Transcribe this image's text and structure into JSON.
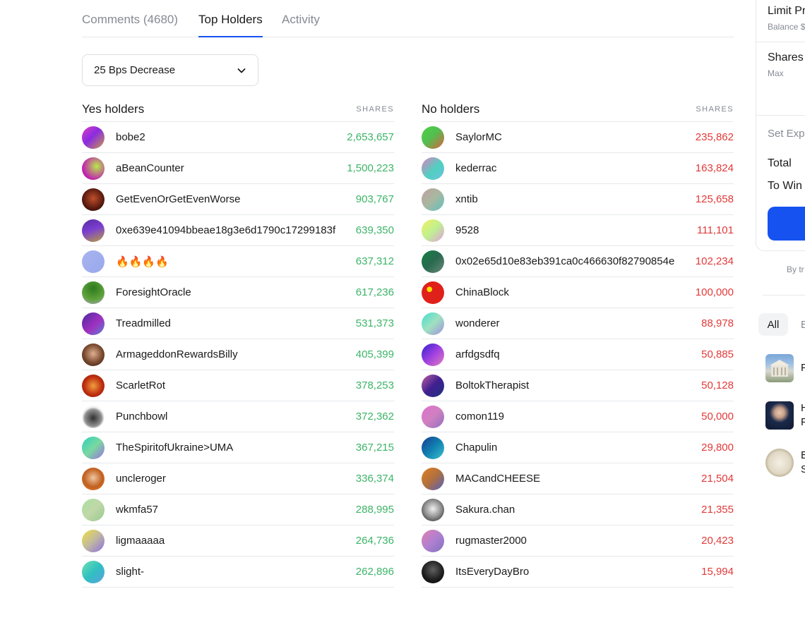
{
  "tabs": [
    {
      "label": "Comments (4680)",
      "active": false
    },
    {
      "label": "Top Holders",
      "active": true
    },
    {
      "label": "Activity",
      "active": false
    }
  ],
  "dropdown": {
    "selected": "25 Bps Decrease",
    "icon": "chevron-down-icon"
  },
  "yes_holders": {
    "title": "Yes holders",
    "shares_label": "SHARES",
    "color": "#3db468",
    "rows": [
      {
        "name": "bobe2",
        "shares": "2,653,657",
        "avatar": "linear-gradient(135deg,#e040c0,#8a2be2 45%,#c89a4a)"
      },
      {
        "name": "aBeanCounter",
        "shares": "1,500,223",
        "avatar": "radial-gradient(circle at 65% 40%,#b8e94a,#c020b0 70%)"
      },
      {
        "name": "GetEvenOrGetEvenWorse",
        "shares": "903,767",
        "avatar": "radial-gradient(circle at 50% 45%,#c0502a,#5a1a10 60%,#1a0a08)"
      },
      {
        "name": "0xe639e41094bbeae18g3e6d1790c17299183f",
        "shares": "639,350",
        "avatar": "linear-gradient(160deg,#5a2aa0,#7a3fd0 45%,#b8a040)"
      },
      {
        "name": "🔥🔥🔥🔥",
        "shares": "637,312",
        "avatar": "linear-gradient(135deg,#a8b4f0,#98a8ec)"
      },
      {
        "name": "ForesightOracle",
        "shares": "617,236",
        "avatar": "radial-gradient(circle at 50% 30%,#2e7a20,#5fa33a 60%,#b8a0d8)"
      },
      {
        "name": "Treadmilled",
        "shares": "531,373",
        "avatar": "linear-gradient(135deg,#4a2aa0,#a030c0 55%,#5a7fd0)"
      },
      {
        "name": "ArmageddonRewardsBilly",
        "shares": "405,399",
        "avatar": "radial-gradient(circle at 50% 45%,#e0b090,#7a4a30 55%,#2a1a10)"
      },
      {
        "name": "ScarletRot",
        "shares": "378,253",
        "avatar": "radial-gradient(circle at 50% 50%,#f0a040,#c03010 55%,#7a1a08)"
      },
      {
        "name": "Punchbowl",
        "shares": "372,362",
        "avatar": "radial-gradient(circle at 50% 55%,#303030,#909090 50%,#f4f4f4 65%)"
      },
      {
        "name": "TheSpiritofUkraine>UMA",
        "shares": "367,215",
        "avatar": "linear-gradient(135deg,#2ad0c0,#7ad8a0 50%,#9a70e0)"
      },
      {
        "name": "uncleroger",
        "shares": "336,374",
        "avatar": "radial-gradient(circle at 50% 45%,#f0c8a0,#c06020 55%,#f08030)"
      },
      {
        "name": "wkmfa57",
        "shares": "288,995",
        "avatar": "linear-gradient(135deg,#a8e0a0,#c0d8a8 50%,#98c890)"
      },
      {
        "name": "ligmaaaaa",
        "shares": "264,736",
        "avatar": "linear-gradient(135deg,#f0e040,#c0b8a0 50%,#8a70e0)"
      },
      {
        "name": "slight-",
        "shares": "262,896",
        "avatar": "linear-gradient(135deg,#70e0b0,#30c0c0 50%,#5aa0e0)"
      }
    ]
  },
  "no_holders": {
    "title": "No holders",
    "shares_label": "SHARES",
    "color": "#e23939",
    "rows": [
      {
        "name": "SaylorMC",
        "shares": "235,862",
        "avatar": "linear-gradient(135deg,#50d040,#50c050 45%,#e06040)"
      },
      {
        "name": "kederrac",
        "shares": "163,824",
        "avatar": "linear-gradient(135deg,#e080c0,#50d0c0 55%,#70c0e0)"
      },
      {
        "name": "xntib",
        "shares": "125,658",
        "avatar": "linear-gradient(135deg,#c0a0a0,#a8b8a0 50%,#60c0c0)"
      },
      {
        "name": "9528",
        "shares": "111,101",
        "avatar": "linear-gradient(135deg,#f0f060,#c0f090 50%,#e0a0e0)"
      },
      {
        "name": "0x02e65d10e83eb391ca0c466630f82790854e",
        "shares": "102,234",
        "avatar": "linear-gradient(135deg,#108040,#2a6a50 50%,#6a8a7a)"
      },
      {
        "name": "ChinaBlock",
        "shares": "100,000",
        "avatar": "radial-gradient(circle at 35% 35%,#ffde00 0,#ffde00 12%,#e0201a 14%)"
      },
      {
        "name": "wonderer",
        "shares": "88,978",
        "avatar": "linear-gradient(135deg,#40e0d0,#a0e0c0 50%,#a090e0)"
      },
      {
        "name": "arfdgsdfq",
        "shares": "50,885",
        "avatar": "linear-gradient(135deg,#3020d0,#a040e0 50%,#e080c0)"
      },
      {
        "name": "BoltokTherapist",
        "shares": "50,128",
        "avatar": "linear-gradient(135deg,#c060a0,#402090 50%,#203080)"
      },
      {
        "name": "comon119",
        "shares": "50,000",
        "avatar": "linear-gradient(135deg,#e070d0,#d080c0 50%,#9070c0)"
      },
      {
        "name": "Chapulin",
        "shares": "29,800",
        "avatar": "linear-gradient(135deg,#1a3a90,#1080b0 50%,#40c0d0)"
      },
      {
        "name": "MACandCHEESE",
        "shares": "21,504",
        "avatar": "linear-gradient(135deg,#e08020,#b07040 50%,#5060c0)"
      },
      {
        "name": "Sakura.chan",
        "shares": "21,355",
        "avatar": "radial-gradient(circle at 50% 45%,#f0f0f0,#909090 50%,#202020)"
      },
      {
        "name": "rugmaster2000",
        "shares": "20,423",
        "avatar": "linear-gradient(135deg,#e080b0,#b080d0 50%,#8070c0)"
      },
      {
        "name": "ItsEveryDayBro",
        "shares": "15,994",
        "avatar": "radial-gradient(circle at 50% 40%,#606060,#202020 55%,#000)"
      }
    ]
  },
  "trade_panel": {
    "limit_label": "Limit Pr",
    "balance_label": "Balance $",
    "shares_label": "Shares",
    "max_label": "Max",
    "set_expiration": "Set Exp",
    "total_label": "Total",
    "to_win_label": "To Win",
    "button_color": "#1652f0"
  },
  "byline": "By tr",
  "related": {
    "chip_all": "All",
    "chip_next": "E",
    "items": [
      {
        "line1": "F",
        "line2": ""
      },
      {
        "line1": "H",
        "line2": "F"
      },
      {
        "line1": "B",
        "line2": "S"
      }
    ]
  }
}
